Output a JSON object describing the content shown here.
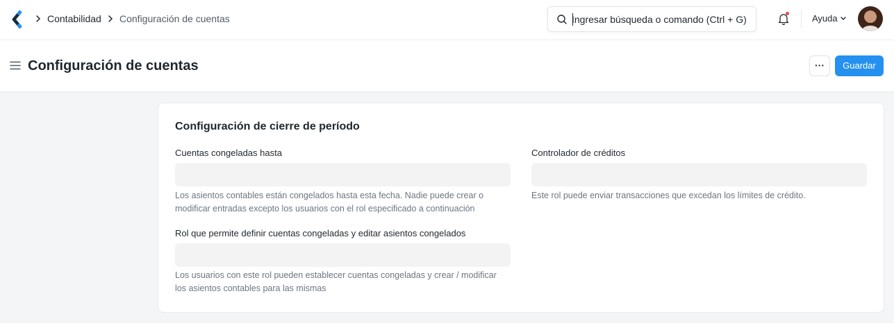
{
  "navbar": {
    "breadcrumbs": [
      "Contabilidad",
      "Configuración de cuentas"
    ],
    "search": {
      "placeholder": "Ingresar búsqueda o comando (Ctrl + G)"
    },
    "help_label": "Ayuda"
  },
  "page": {
    "title": "Configuración de cuentas",
    "more_label": "···",
    "save_label": "Guardar"
  },
  "form": {
    "section_title": "Configuración de cierre de período",
    "fields": [
      {
        "label": "Cuentas congeladas hasta",
        "value": "",
        "description": "Los asientos contables están congelados hasta esta fecha. Nadie puede crear o modificar entradas excepto los usuarios con el rol especificado a continuación"
      },
      {
        "label": "Controlador de créditos",
        "value": "",
        "description": "Este rol puede enviar transacciones que excedan los límites de crédito."
      },
      {
        "label": "Rol que permite definir cuentas congeladas y editar asientos congelados",
        "value": "",
        "description": "Los usuarios con este rol pueden establecer cuentas congeladas y crear / modificar los asientos contables para las mismas"
      }
    ]
  },
  "colors": {
    "primary": "#2490ef",
    "notification_dot": "#e24c4c",
    "input_background": "#f3f3f4"
  }
}
